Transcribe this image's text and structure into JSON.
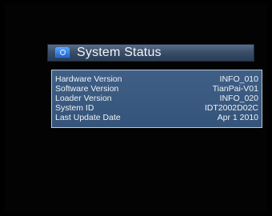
{
  "dialog": {
    "title": "System Status",
    "icon": "info-icon"
  },
  "status_rows": [
    {
      "label": "Hardware Version",
      "value": "INFO_010"
    },
    {
      "label": "Software Version",
      "value": "TianPai-V01"
    },
    {
      "label": "Loader Version",
      "value": "INFO_020"
    },
    {
      "label": "System ID",
      "value": "IDT2002D02C"
    },
    {
      "label": "Last Update Date",
      "value": "Apr  1 2010"
    }
  ]
}
